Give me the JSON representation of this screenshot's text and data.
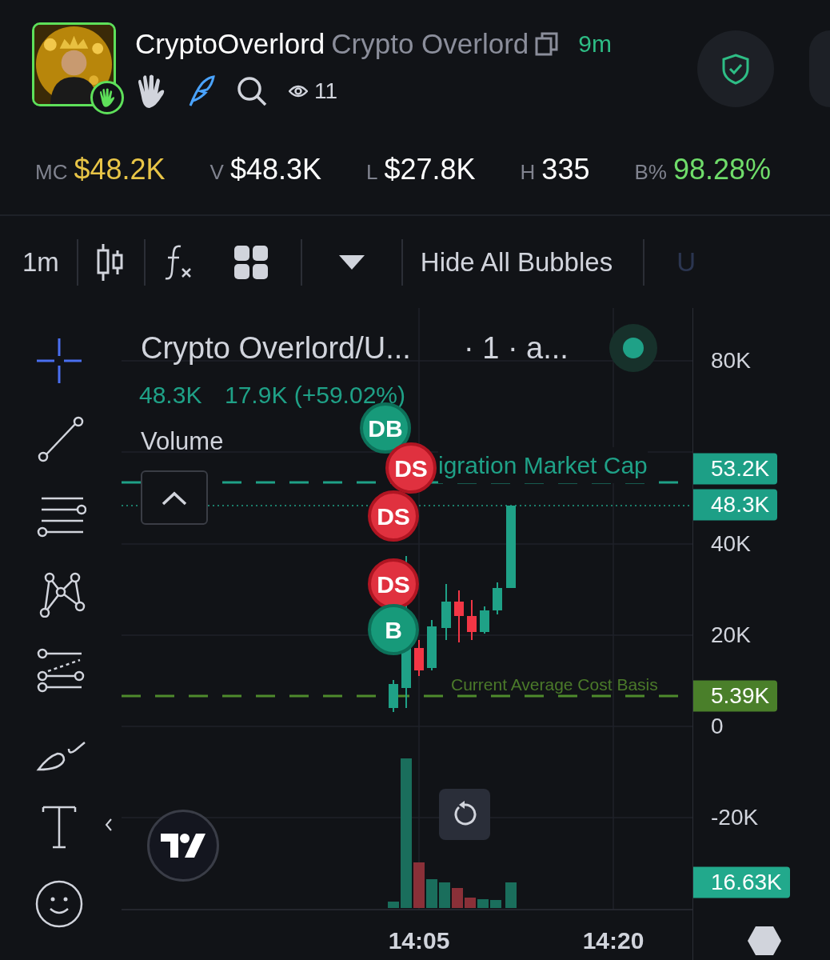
{
  "header": {
    "avatar": {
      "kind": "picture",
      "badge": true
    },
    "name": "CryptoOverlord",
    "alias": "Crypto Overlord",
    "age": "9m",
    "views": "11"
  },
  "stats": [
    {
      "label": "MC",
      "value": "$48.2K",
      "color": "#e8c547"
    },
    {
      "label": "V",
      "value": "$48.3K",
      "color": "#ffffff"
    },
    {
      "label": "L",
      "value": "$27.8K",
      "color": "#ffffff"
    },
    {
      "label": "H",
      "value": "335",
      "color": "#ffffff"
    },
    {
      "label": "B%",
      "value": "98.28%",
      "color": "#6fdc6a"
    }
  ],
  "toolbar": {
    "interval": "1m",
    "bubbles_button": "Hide All Bubbles",
    "currency": "U"
  },
  "tools": [
    {
      "selected": true
    },
    {
      "selected": false
    },
    {
      "selected": false
    },
    {
      "selected": false
    },
    {
      "selected": false
    },
    {
      "selected": false
    },
    {
      "selected": false
    },
    {
      "selected": false
    }
  ],
  "chart": {
    "symbol": "Crypto Overlord/U...",
    "interval": "· 1 · a...",
    "last": "48.3K",
    "change": "17.9K (+59.02%)",
    "volume_label": "Volume",
    "lines": [
      {
        "kind": "migration",
        "label": "igration Market Cap"
      },
      {
        "kind": "cost",
        "label": "Current Average Cost Basis"
      }
    ],
    "bubbles": [
      {
        "text": "DB",
        "kind": "buy"
      },
      {
        "text": "DS",
        "kind": "sell"
      },
      {
        "text": "DS",
        "kind": "sell"
      },
      {
        "text": "DS",
        "kind": "sell"
      },
      {
        "text": "B",
        "kind": "buy"
      }
    ],
    "y_axis": [
      "80K",
      "40K",
      "20K",
      "0",
      "-20K"
    ],
    "price_tags": [
      {
        "text": "53.2K",
        "color": "#1d9f86"
      },
      {
        "text": "48.3K",
        "color": "#1d9f86"
      },
      {
        "text": "5.39K",
        "color": "#4a7f2a"
      },
      {
        "text": "16.63K",
        "color": "#22a98c"
      }
    ],
    "x_axis": [
      "14:05",
      "14:20"
    ]
  }
}
